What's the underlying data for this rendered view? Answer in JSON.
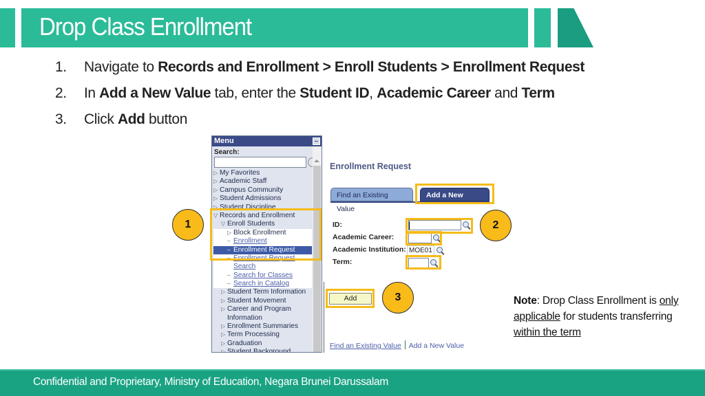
{
  "header": {
    "title": "Drop Class Enrollment"
  },
  "steps": [
    {
      "number": "1.",
      "parts": [
        {
          "text": "Navigate to ",
          "bold": false
        },
        {
          "text": "Records and Enrollment > Enroll Students > Enrollment Request",
          "bold": true
        }
      ]
    },
    {
      "number": "2.",
      "parts": [
        {
          "text": "In ",
          "bold": false
        },
        {
          "text": "Add a New Value",
          "bold": true
        },
        {
          "text": " tab, enter the ",
          "bold": false
        },
        {
          "text": "Student ID",
          "bold": true
        },
        {
          "text": ", ",
          "bold": false
        },
        {
          "text": "Academic Career",
          "bold": true
        },
        {
          "text": " and ",
          "bold": false
        },
        {
          "text": "Term",
          "bold": true
        }
      ]
    },
    {
      "number": "3.",
      "parts": [
        {
          "text": "Click ",
          "bold": false
        },
        {
          "text": "Add",
          "bold": true
        },
        {
          "text": " button",
          "bold": false
        }
      ]
    }
  ],
  "menu": {
    "title": "Menu",
    "search_label": "Search:",
    "search_value": "",
    "items": [
      {
        "label": "My Favorites",
        "level": 0,
        "icon": "triangle-right"
      },
      {
        "label": "Academic Staff",
        "level": 0,
        "icon": "triangle-right"
      },
      {
        "label": "Campus Community",
        "level": 0,
        "icon": "triangle-right"
      },
      {
        "label": "Student Admissions",
        "level": 0,
        "icon": "triangle-right"
      },
      {
        "label": "Student Discipline",
        "level": 0,
        "icon": "triangle-right"
      },
      {
        "label": "Records and Enrollment",
        "level": 0,
        "icon": "triangle-down"
      },
      {
        "label": "Enroll Students",
        "level": 1,
        "icon": "triangle-down"
      },
      {
        "label": "Block Enrollment",
        "level": 2,
        "icon": "triangle-right"
      },
      {
        "label": "Enrollment",
        "level": 2,
        "icon": "dash",
        "link": true
      },
      {
        "label": "Enrollment Request",
        "level": 2,
        "icon": "dash",
        "selected": true
      },
      {
        "label": "Enrollment Request",
        "level": 2,
        "icon": "dash",
        "link": true
      },
      {
        "label": "Search",
        "level": 2,
        "icon": "none",
        "link": true,
        "continuation": true
      },
      {
        "label": "Search for Classes",
        "level": 2,
        "icon": "dash",
        "link": true
      },
      {
        "label": "Search in Catalog",
        "level": 2,
        "icon": "dash",
        "link": true
      },
      {
        "label": "Student Term Information",
        "level": 1,
        "icon": "triangle-right"
      },
      {
        "label": "Student Movement",
        "level": 1,
        "icon": "triangle-right"
      },
      {
        "label": "Career and Program",
        "level": 1,
        "icon": "triangle-right"
      },
      {
        "label": "Information",
        "level": 1,
        "icon": "none",
        "continuation": true
      },
      {
        "label": "Enrollment Summaries",
        "level": 1,
        "icon": "triangle-right"
      },
      {
        "label": "Term Processing",
        "level": 1,
        "icon": "triangle-right"
      },
      {
        "label": "Graduation",
        "level": 1,
        "icon": "triangle-right"
      },
      {
        "label": "Student Background",
        "level": 1,
        "icon": "triangle-right"
      }
    ]
  },
  "form": {
    "title": "Enrollment Request",
    "tabs": {
      "find": "Find an Existing Value",
      "add": "Add a New Value",
      "active": "add"
    },
    "fields": {
      "id": {
        "label": "ID:",
        "value": ""
      },
      "academic_career": {
        "label": "Academic Career:",
        "value": ""
      },
      "academic_institution": {
        "label": "Academic Institution:",
        "value": "MOE01"
      },
      "term": {
        "label": "Term:",
        "value": ""
      }
    },
    "add_button": "Add",
    "bottom_links": {
      "find": "Find an Existing Value",
      "add": "Add a New Value"
    }
  },
  "callouts": {
    "one": "1",
    "two": "2",
    "three": "3"
  },
  "note": {
    "label": "Note",
    "text1": ": Drop Class Enrollment is ",
    "underline1": "only applicable",
    "text2": " for students transferring ",
    "underline2": "within the term"
  },
  "footer": {
    "text": "Confidential and Proprietary, Ministry of Education, Negara Brunei Darussalam"
  },
  "colors": {
    "brand_teal": "#2bbb98",
    "brand_teal_dark": "#1a9d80",
    "highlight": "#f5bb19",
    "callout_fill": "#f8bb1a",
    "ps_navy": "#3a4a86"
  }
}
